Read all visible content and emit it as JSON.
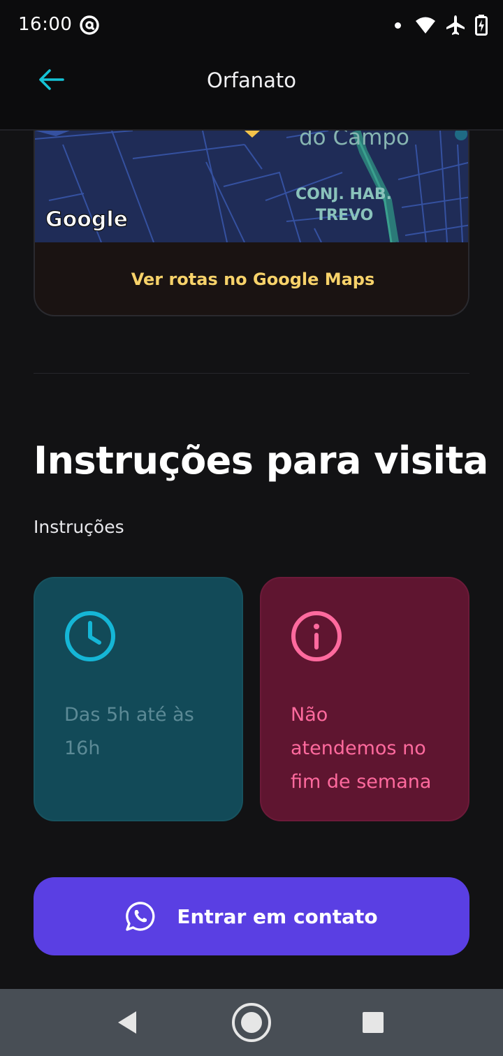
{
  "status_bar": {
    "time": "16:00",
    "icons": [
      "at-sign-icon",
      "notification-dot-icon",
      "wifi-icon",
      "airplane-mode-icon",
      "battery-charging-icon"
    ]
  },
  "app_bar": {
    "title": "Orfanato",
    "back_icon": "arrow-left-icon",
    "accent_color": "#15c3d6"
  },
  "map": {
    "labels": {
      "district": "do Campo",
      "neighborhood_line1": "CONJ. HAB.",
      "neighborhood_line2": "TREVO",
      "logo": "Google"
    },
    "link_label": "Ver rotas no Google Maps",
    "link_color": "#f7d26a"
  },
  "instructions": {
    "title": "Instruções para visita",
    "subtitle": "Instruções",
    "cards": [
      {
        "icon": "clock-icon",
        "text": "Das 5h até às 16h",
        "color": "#15b6d6"
      },
      {
        "icon": "info-icon",
        "text": "Não atendemos no fim de semana",
        "color": "#ff6a9e"
      }
    ]
  },
  "contact_button": {
    "label": "Entrar em contato",
    "icon": "whatsapp-icon",
    "color": "#5a3fe3"
  },
  "nav_bar": {
    "buttons": [
      "back-triangle-icon",
      "home-circle-icon",
      "recents-square-icon"
    ]
  }
}
